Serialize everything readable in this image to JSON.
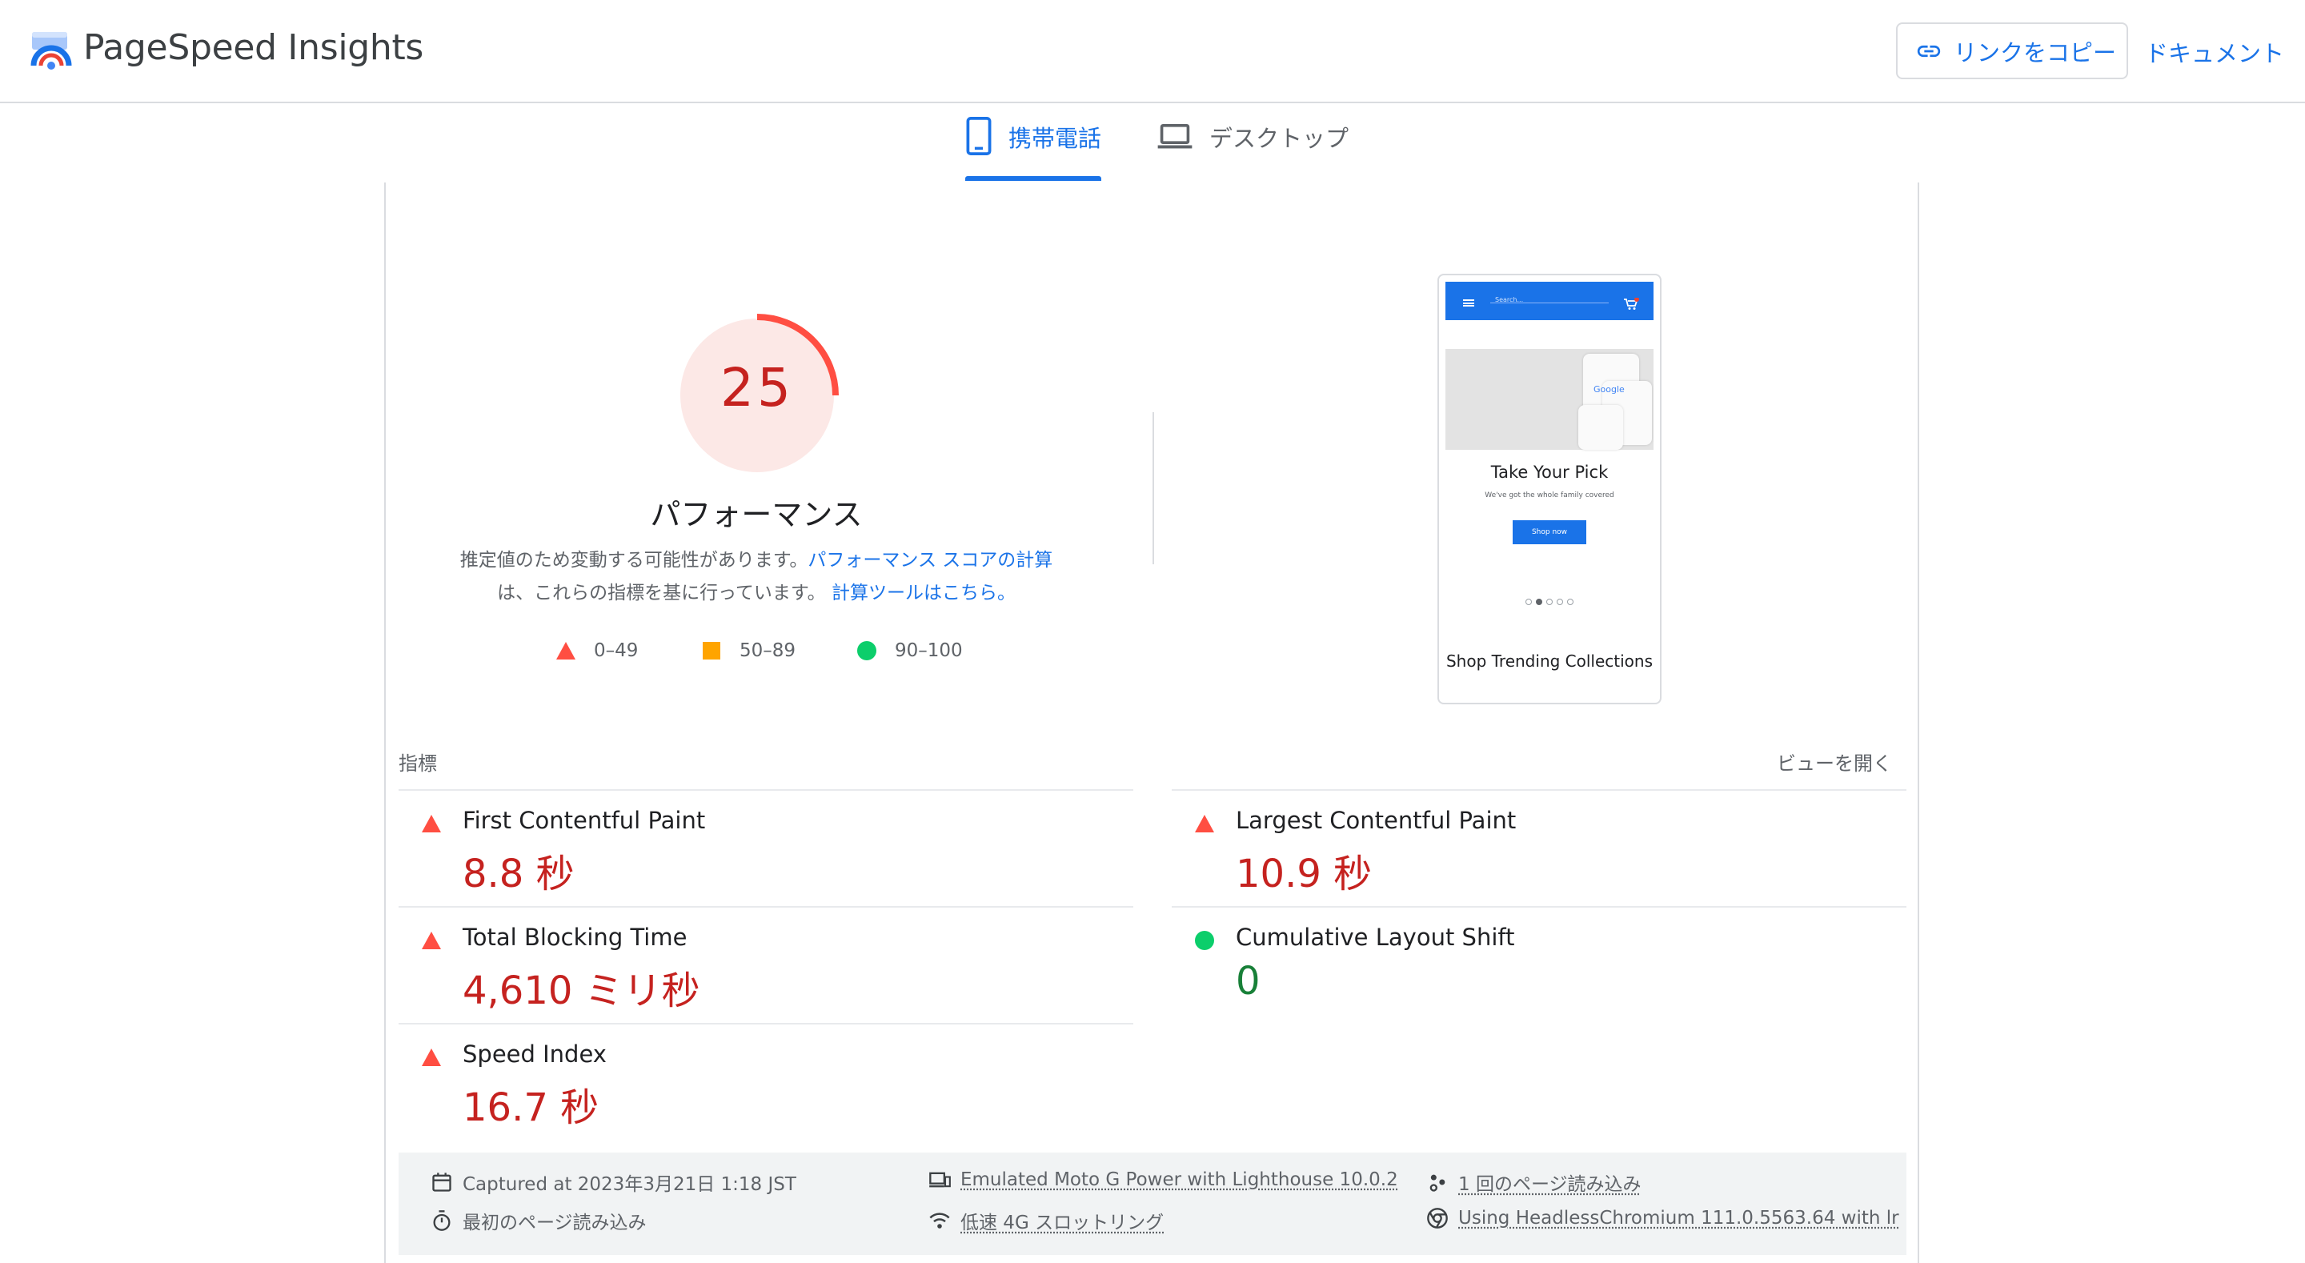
{
  "header": {
    "brand": "PageSpeed Insights",
    "copy_link_label": "リンクをコピー",
    "docs_label": "ドキュメント"
  },
  "tabs": [
    {
      "label": "携帯電話",
      "active": true
    },
    {
      "label": "デスクトップ",
      "active": false
    }
  ],
  "performance": {
    "score": "25",
    "score_fraction": 0.25,
    "title": "パフォーマンス",
    "desc_part1": "推定値のため変動する可能性があります。",
    "desc_link1": "パフォーマンス スコアの計算",
    "desc_part2": "は、これらの指標を基に行っています。",
    "desc_link2": "計算ツールはこちら。"
  },
  "legend": [
    {
      "range": "0–49",
      "color": "#ff4e42"
    },
    {
      "range": "50–89",
      "color": "#ffa400"
    },
    {
      "range": "90–100",
      "color": "#0cce6b"
    }
  ],
  "thumbnail": {
    "search": "Search...",
    "headline": "Take Your Pick",
    "subline": "We've got the whole family covered",
    "button": "Shop now",
    "section": "Shop Trending Collections",
    "brand_on_shirt": "Google"
  },
  "metrics": {
    "label": "指標",
    "expand_label": "ビューを開く",
    "items": [
      {
        "name": "First Contentful Paint",
        "value": "8.8 秒",
        "status": "bad"
      },
      {
        "name": "Largest Contentful Paint",
        "value": "10.9 秒",
        "status": "bad"
      },
      {
        "name": "Total Blocking Time",
        "value": "4,610 ミリ秒",
        "status": "bad"
      },
      {
        "name": "Cumulative Layout Shift",
        "value": "0",
        "status": "good"
      },
      {
        "name": "Speed Index",
        "value": "16.7 秒",
        "status": "bad"
      }
    ]
  },
  "info": {
    "captured": "Captured at 2023年3月21日 1:18 JST",
    "first_load": "最初のページ読み込み",
    "device": "Emulated Moto G Power with Lighthouse 10.0.2",
    "throttling": "低速 4G スロットリング",
    "page_loads": "1 回のページ読み込み",
    "browser": "Using HeadlessChromium 111.0.5563.64 with lr"
  },
  "colors": {
    "accent": "#1a73e8",
    "fail": "#ff4e42",
    "fail_text": "#c5221f",
    "pass_text": "#188038"
  }
}
